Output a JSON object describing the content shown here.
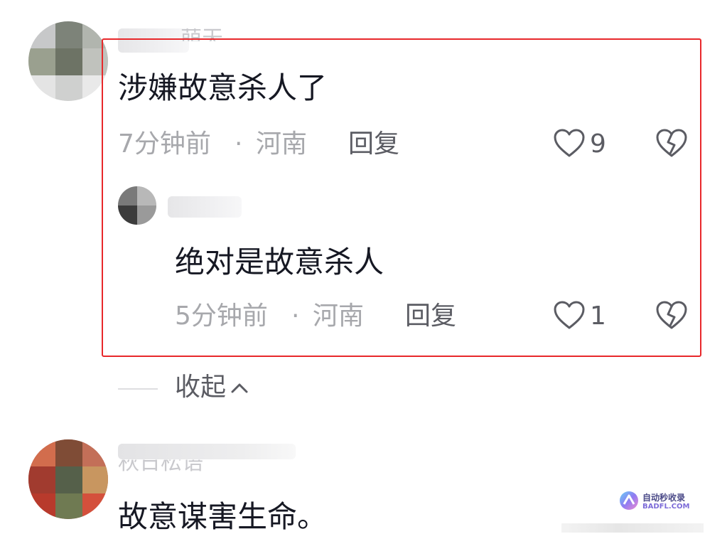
{
  "top_comment": {
    "author_partial": "萌天",
    "text": "涉嫌故意杀人了",
    "time": "7分钟前",
    "separator": "·",
    "location": "河南",
    "reply_label": "回复",
    "likes": "9",
    "like_icon": "heart-outline-icon",
    "dislike_icon": "broken-heart-icon"
  },
  "reply": {
    "author_partial": "",
    "text": "绝对是故意杀人",
    "time": "5分钟前",
    "separator": "·",
    "location": "河南",
    "reply_label": "回复",
    "likes": "1",
    "like_icon": "heart-outline-icon",
    "dislike_icon": "broken-heart-icon"
  },
  "collapse": {
    "label": "收起",
    "icon": "chevron-up-icon"
  },
  "next_comment": {
    "author_partial": "秋日松语",
    "text": "故意谋害生命。"
  },
  "watermark": {
    "line1": "自动秒收录",
    "line2": "BADFL.COM"
  },
  "colors": {
    "highlight_border": "#e8282b",
    "primary_text": "#161823",
    "secondary_text": "#a7a8ac",
    "action_text": "#5b5c63"
  }
}
